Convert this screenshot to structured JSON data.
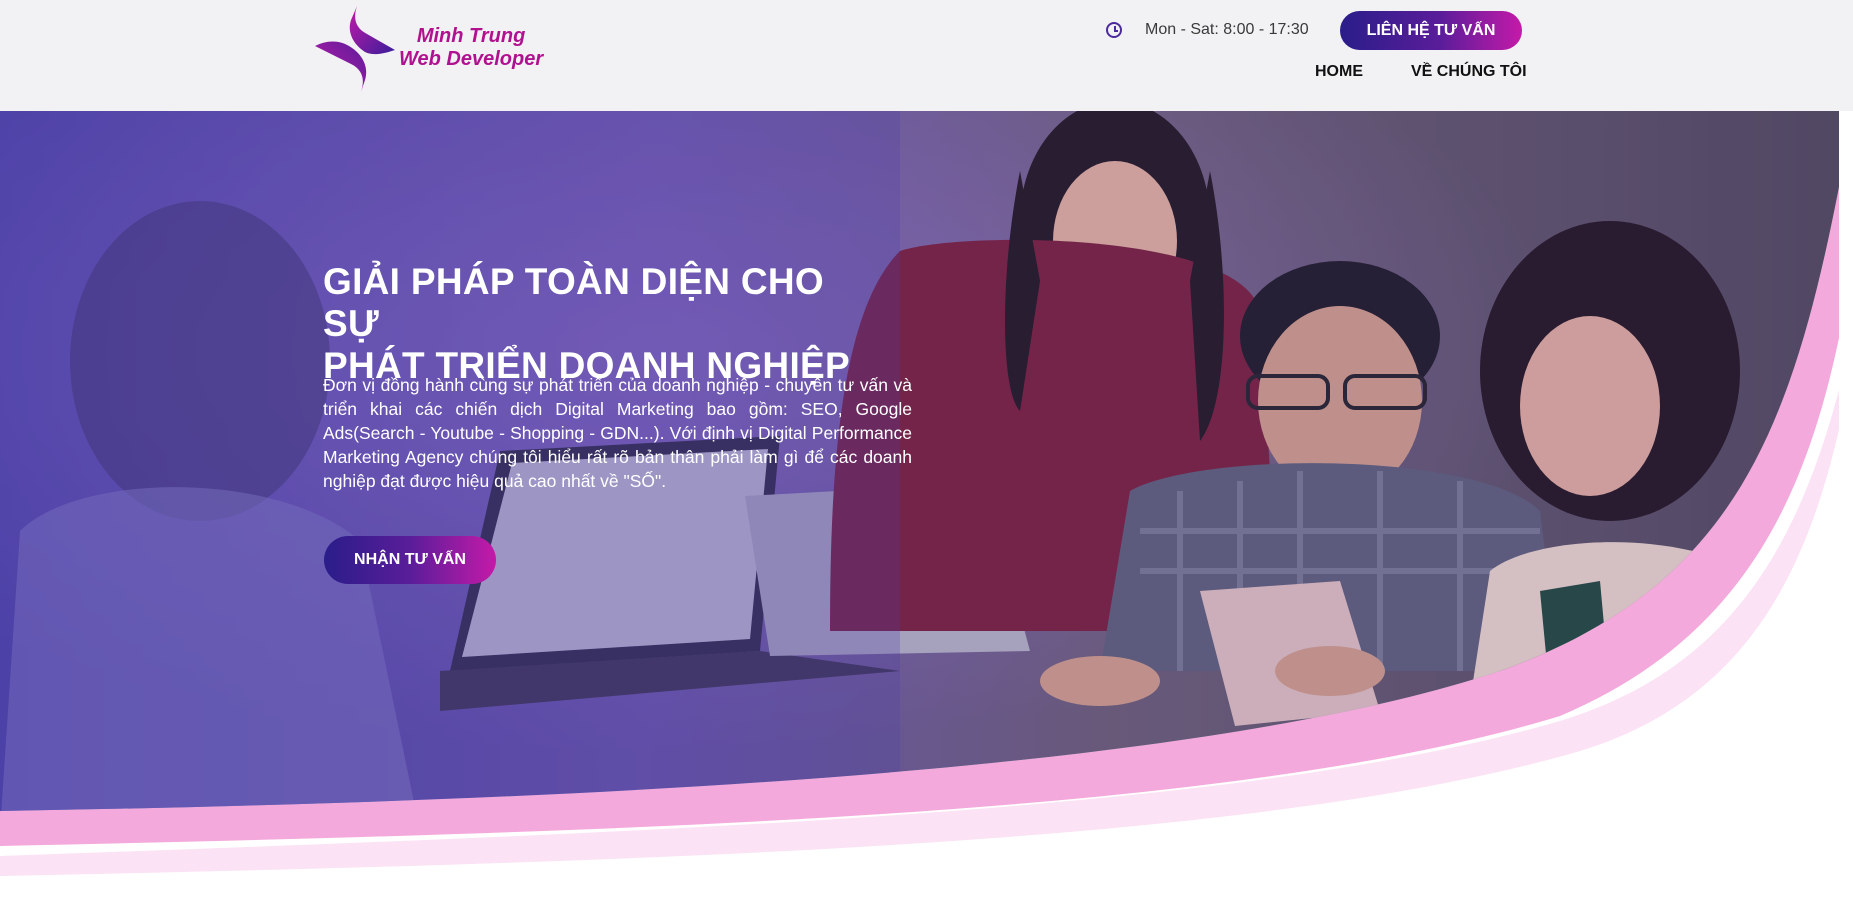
{
  "brand": {
    "line1": "Minh Trung",
    "line2": "Web Developer",
    "accent_color": "#b0128f",
    "primary_color": "#2a1d8a"
  },
  "header": {
    "hours_icon": "clock-icon",
    "hours": "Mon - Sat: 8:00 - 17:30",
    "contact_label": "LIÊN HỆ TƯ VẤN",
    "nav": [
      {
        "label": "HOME"
      },
      {
        "label": "VỀ CHÚNG TÔI"
      }
    ]
  },
  "hero": {
    "title_line1": "GIẢI PHÁP TOÀN DIỆN CHO SỰ",
    "title_line2": "PHÁT TRIỂN DOANH NGHIỆP",
    "description": "Đơn vị đồng hành cùng sự phát triển của doanh nghiệp - chuyên tư vấn và triển khai các chiến dịch Digital Marketing bao gồm: SEO, Google Ads(Search - Youtube - Shopping - GDN...). Với định vị Digital Performance Marketing Agency chúng tôi hiểu rất rõ bản thân phải làm gì để các doanh nghiệp đạt được hiệu quả cao nhất về \"SỐ\".",
    "cta_label": "NHẬN TƯ VẤN",
    "wave_color": "#f4a9dc"
  }
}
